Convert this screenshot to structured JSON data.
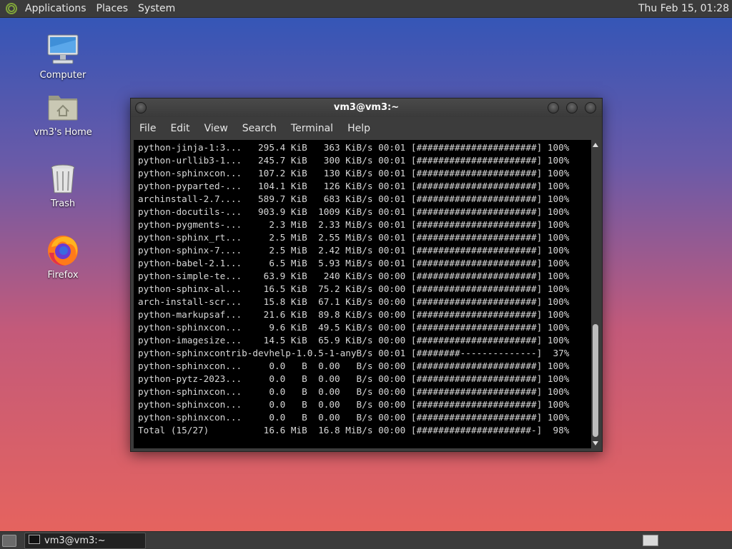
{
  "top_panel": {
    "menus": [
      "Applications",
      "Places",
      "System"
    ],
    "clock": "Thu Feb 15, 01:28"
  },
  "desktop_icons": [
    {
      "label": "Computer",
      "icon": "computer-icon"
    },
    {
      "label": "vm3's Home",
      "icon": "home-folder-icon"
    },
    {
      "label": "Trash",
      "icon": "trash-icon"
    },
    {
      "label": "Firefox",
      "icon": "firefox-icon"
    }
  ],
  "terminal": {
    "title": "vm3@vm3:~",
    "menus": [
      "File",
      "Edit",
      "View",
      "Search",
      "Terminal",
      "Help"
    ],
    "lines": [
      "python-jinja-1:3...   295.4 KiB   363 KiB/s 00:01 [######################] 100%",
      "python-urllib3-1...   245.7 KiB   300 KiB/s 00:01 [######################] 100%",
      "python-sphinxcon...   107.2 KiB   130 KiB/s 00:01 [######################] 100%",
      "python-pyparted-...   104.1 KiB   126 KiB/s 00:01 [######################] 100%",
      "archinstall-2.7....   589.7 KiB   683 KiB/s 00:01 [######################] 100%",
      "python-docutils-...   903.9 KiB  1009 KiB/s 00:01 [######################] 100%",
      "python-pygments-...     2.3 MiB  2.33 MiB/s 00:01 [######################] 100%",
      "python-sphinx_rt...     2.5 MiB  2.55 MiB/s 00:01 [######################] 100%",
      "python-sphinx-7....     2.5 MiB  2.42 MiB/s 00:01 [######################] 100%",
      "python-babel-2.1...     6.5 MiB  5.93 MiB/s 00:01 [######################] 100%",
      "python-simple-te...    63.9 KiB   240 KiB/s 00:00 [######################] 100%",
      "python-sphinx-al...    16.5 KiB  75.2 KiB/s 00:00 [######################] 100%",
      "arch-install-scr...    15.8 KiB  67.1 KiB/s 00:00 [######################] 100%",
      "python-markupsaf...    21.6 KiB  89.8 KiB/s 00:00 [######################] 100%",
      "python-sphinxcon...     9.6 KiB  49.5 KiB/s 00:00 [######################] 100%",
      "python-imagesize...    14.5 KiB  65.9 KiB/s 00:00 [######################] 100%",
      "python-sphinxcontrib-devhelp-1.0.5-1-anyB/s 00:01 [########--------------]  37%",
      "python-sphinxcon...     0.0   B  0.00   B/s 00:00 [######################] 100%",
      "python-pytz-2023...     0.0   B  0.00   B/s 00:00 [######################] 100%",
      "python-sphinxcon...     0.0   B  0.00   B/s 00:00 [######################] 100%",
      "python-sphinxcon...     0.0   B  0.00   B/s 00:00 [######################] 100%",
      "python-sphinxcon...     0.0   B  0.00   B/s 00:00 [######################] 100%",
      "Total (15/27)          16.6 MiB  16.8 MiB/s 00:00 [#####################-]  98%"
    ]
  },
  "bottom_panel": {
    "task_label": "vm3@vm3:~"
  }
}
